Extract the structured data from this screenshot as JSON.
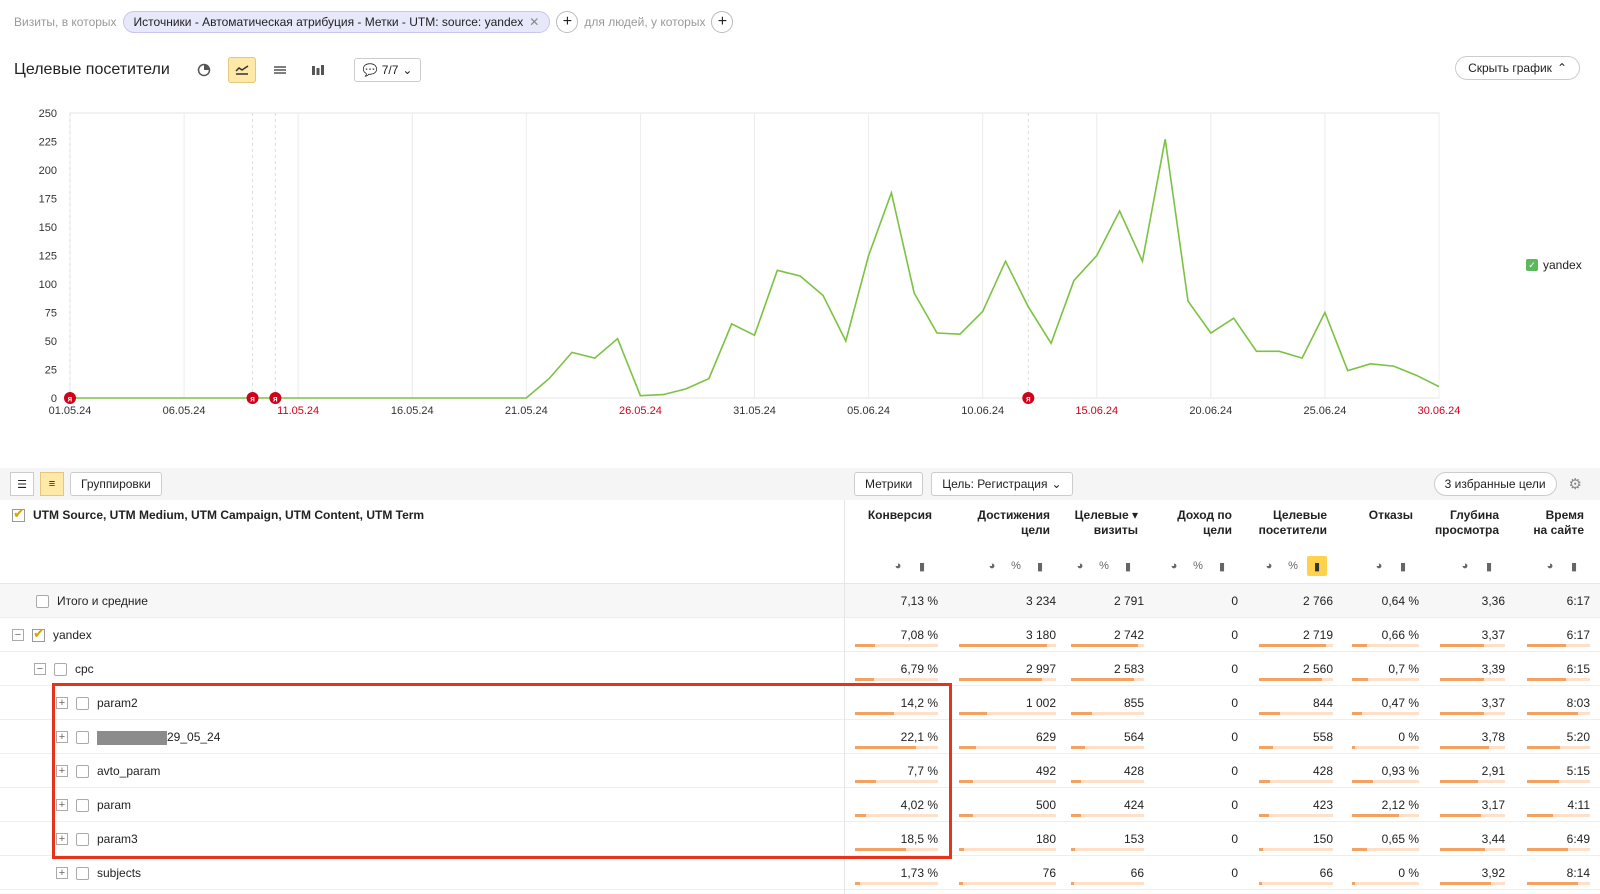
{
  "filter": {
    "visits_label": "Визиты, в которых",
    "chip_text": "Источники - Автоматическая атрибуция - Метки - UTM: source: yandex",
    "people_label": "для людей, у которых"
  },
  "chart_header": {
    "title": "Целевые посетители",
    "annotations_count": "7/7",
    "hide_chart": "Скрыть график"
  },
  "chart_data": {
    "type": "line",
    "x": [
      "01.05.24",
      "02.05.24",
      "03.05.24",
      "04.05.24",
      "05.05.24",
      "06.05.24",
      "07.05.24",
      "08.05.24",
      "09.05.24",
      "10.05.24",
      "11.05.24",
      "12.05.24",
      "13.05.24",
      "14.05.24",
      "15.05.24",
      "16.05.24",
      "17.05.24",
      "18.05.24",
      "19.05.24",
      "20.05.24",
      "21.05.24",
      "22.05.24",
      "23.05.24",
      "24.05.24",
      "25.05.24",
      "26.05.24",
      "27.05.24",
      "28.05.24",
      "29.05.24",
      "30.05.24",
      "31.05.24",
      "01.06.24",
      "02.06.24",
      "03.06.24",
      "04.06.24",
      "05.06.24",
      "06.06.24",
      "07.06.24",
      "08.06.24",
      "09.06.24",
      "10.06.24",
      "11.06.24",
      "12.06.24",
      "13.06.24",
      "14.06.24",
      "15.06.24",
      "16.06.24",
      "17.06.24",
      "18.06.24",
      "19.06.24",
      "20.06.24",
      "21.06.24",
      "22.06.24",
      "23.06.24",
      "24.06.24",
      "25.06.24",
      "26.06.24",
      "27.06.24",
      "28.06.24",
      "29.06.24",
      "30.06.24"
    ],
    "tick_labels": [
      "01.05.24",
      "06.05.24",
      "11.05.24",
      "16.05.24",
      "21.05.24",
      "26.05.24",
      "31.05.24",
      "05.06.24",
      "10.06.24",
      "15.06.24",
      "20.06.24",
      "25.06.24",
      "30.06.24"
    ],
    "red_ticks": [
      "11.05.24",
      "26.05.24",
      "15.06.24",
      "30.06.24"
    ],
    "marker_dates": [
      "01.05.24",
      "09.05.24",
      "10.05.24",
      "12.06.24"
    ],
    "series": [
      {
        "name": "yandex",
        "color": "#7cc242",
        "values": [
          0,
          0,
          0,
          0,
          0,
          0,
          0,
          0,
          0,
          0,
          0,
          0,
          0,
          0,
          0,
          0,
          0,
          0,
          0,
          0,
          0,
          17,
          40,
          35,
          52,
          2,
          3,
          8,
          17,
          65,
          55,
          112,
          107,
          90,
          50,
          125,
          180,
          92,
          57,
          56,
          76,
          120,
          80,
          48,
          103,
          125,
          164,
          120,
          227,
          85,
          57,
          70,
          41,
          41,
          35,
          75,
          24,
          30,
          28,
          20,
          10,
          8
        ]
      }
    ],
    "ylim": [
      0,
      250
    ],
    "yticks": [
      0,
      25,
      50,
      75,
      100,
      125,
      150,
      175,
      200,
      225,
      250
    ]
  },
  "toolbar": {
    "groupings": "Группировки",
    "metrics": "Метрики",
    "goal": "Цель: Регистрация",
    "fav_goals": "3 избранные цели"
  },
  "table": {
    "dim_header": "UTM Source, UTM Medium, UTM Campaign, UTM Content, UTM Term",
    "columns": [
      {
        "title": "Конверсия",
        "title2": ""
      },
      {
        "title": "Достижения",
        "title2": "цели"
      },
      {
        "title": "Целевые",
        "title2": "визиты"
      },
      {
        "title": "Доход по",
        "title2": "цели"
      },
      {
        "title": "Целевые",
        "title2": "посетители"
      },
      {
        "title": "Отказы",
        "title2": ""
      },
      {
        "title": "Глубина",
        "title2": "просмотра"
      },
      {
        "title": "Время",
        "title2": "на сайте"
      }
    ],
    "total": {
      "label": "Итого и средние",
      "values": [
        "7,13 %",
        "3 234",
        "2 791",
        "0",
        "2 766",
        "0,64 %",
        "3,36",
        "6:17"
      ]
    },
    "rows": [
      {
        "label": "yandex",
        "values": [
          "7,08 %",
          "3 180",
          "2 742",
          "0",
          "2 719",
          "0,66 %",
          "3,37",
          "6:17"
        ]
      },
      {
        "label": "cpc",
        "values": [
          "6,79 %",
          "2 997",
          "2 583",
          "0",
          "2 560",
          "0,7 %",
          "3,39",
          "6:15"
        ]
      },
      {
        "label": "param2",
        "values": [
          "14,2 %",
          "1 002",
          "855",
          "0",
          "844",
          "0,47 %",
          "3,37",
          "8:03"
        ]
      },
      {
        "label": "29_05_24",
        "values": [
          "22,1 %",
          "629",
          "564",
          "0",
          "558",
          "0 %",
          "3,78",
          "5:20"
        ]
      },
      {
        "label": "avto_param",
        "values": [
          "7,7 %",
          "492",
          "428",
          "0",
          "428",
          "0,93 %",
          "2,91",
          "5:15"
        ]
      },
      {
        "label": "param",
        "values": [
          "4,02 %",
          "500",
          "424",
          "0",
          "423",
          "2,12 %",
          "3,17",
          "4:11"
        ]
      },
      {
        "label": "param3",
        "values": [
          "18,5 %",
          "180",
          "153",
          "0",
          "150",
          "0,65 %",
          "3,44",
          "6:49"
        ]
      },
      {
        "label": "subjects",
        "values": [
          "1,73 %",
          "76",
          "66",
          "0",
          "66",
          "0 %",
          "3,92",
          "8:14"
        ]
      }
    ]
  }
}
